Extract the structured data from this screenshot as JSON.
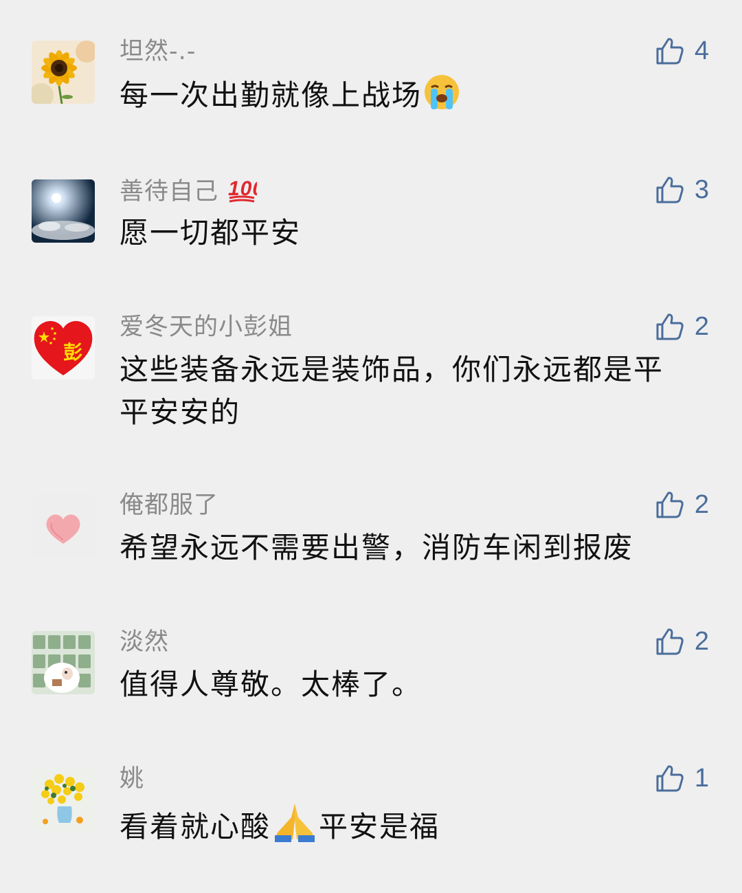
{
  "comments": [
    {
      "name": "坦然-.-",
      "text": "每一次出勤就像上战场",
      "emoji": "loudly-crying-face",
      "likes": "4"
    },
    {
      "name": "善待自己",
      "name_emoji": "hundred-points",
      "text": "愿一切都平安",
      "likes": "3"
    },
    {
      "name": "爱冬天的小彭姐",
      "text": "这些装备永远是装饰品，你们永远都是平平安安的",
      "likes": "2",
      "avatar_text": "彭"
    },
    {
      "name": "俺都服了",
      "text": "希望永远不需要出警，消防车闲到报废",
      "likes": "2"
    },
    {
      "name": "淡然",
      "text": "值得人尊敬。太棒了。",
      "likes": "2"
    },
    {
      "name": "姚",
      "text_before": "看着就心酸",
      "emoji": "folded-hands",
      "text_after": "平安是福",
      "likes": "1"
    }
  ],
  "icons": {
    "like": "thumbs-up-outline-icon"
  },
  "colors": {
    "background": "#efeff0",
    "name": "#8a8a8a",
    "like": "#4a6d9a"
  }
}
